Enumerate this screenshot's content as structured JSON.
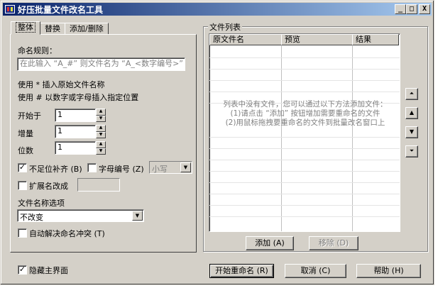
{
  "window": {
    "title": "好压批量文件改名工具",
    "buttons": {
      "minimize": "_",
      "maximize": "□",
      "close": "X"
    }
  },
  "tabs": [
    {
      "label": "整体",
      "active": true
    },
    {
      "label": "替换",
      "active": false
    },
    {
      "label": "添加/删除",
      "active": false
    }
  ],
  "rule": {
    "label": "命名规则：",
    "placeholder": "在此输入 “A_#” 则文件名为 “A_<数字编号>”",
    "hint1": "使用 * 插入原始文件名称",
    "hint2": "使用 # 以数字或字母插入指定位置"
  },
  "fields": {
    "start": {
      "label": "开始于",
      "value": "1"
    },
    "step": {
      "label": "增量",
      "value": "1"
    },
    "digits": {
      "label": "位数",
      "value": "1"
    }
  },
  "options": {
    "pad_zero": {
      "label": "不足位补齐 (B)",
      "checked": true
    },
    "letter_num": {
      "label": "字母编号 (Z)",
      "checked": false
    },
    "case_select": {
      "value": "小写"
    },
    "ext_change": {
      "label": "扩展名改成",
      "checked": false
    },
    "name_opt_label": "文件名称选项",
    "name_opt_value": "不改变",
    "auto_resolve": {
      "label": "自动解决命名冲突 (T)",
      "checked": false
    }
  },
  "file_list": {
    "group_label": "文件列表",
    "columns": [
      "原文件名",
      "预览",
      "结果"
    ],
    "empty_lines": [
      "列表中没有文件，您可以通过以下方法添加文件：",
      "(1)请点击 “添加” 按钮增加需要重命名的文件",
      "(2)用鼠标拖拽要重命名的文件到批量改名窗口上"
    ],
    "add_button": "添加 (A)",
    "remove_button": "移除 (D)"
  },
  "side_buttons": [
    "move-top",
    "move-up",
    "move-down",
    "move-bottom"
  ],
  "footer": {
    "hide_main": {
      "label": "隐藏主界面",
      "checked": true
    },
    "start_rename": "开始重命名 (R)",
    "cancel": "取消 (C)",
    "help": "帮助 (H)"
  }
}
